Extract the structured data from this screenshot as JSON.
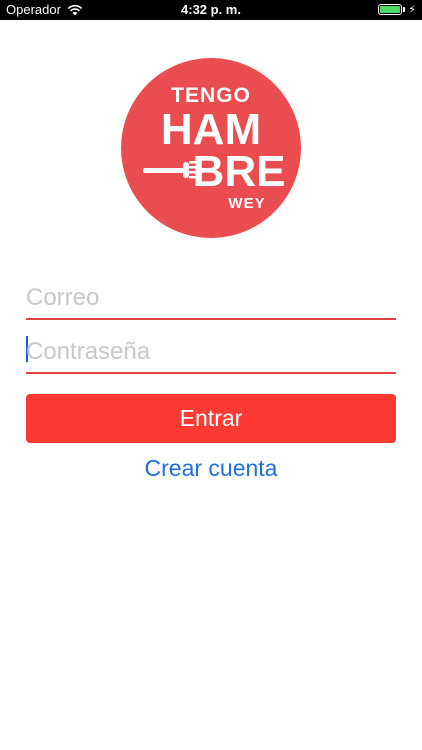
{
  "status_bar": {
    "carrier": "Operador",
    "time": "4:32 p. m.",
    "battery_level": 1.0,
    "battery_color": "#4cd964"
  },
  "logo": {
    "line1": "TENGO",
    "line2a": "HAM",
    "line2b": "BRE",
    "line3": "WEY",
    "color": "#ea4d50"
  },
  "form": {
    "email_placeholder": "Correo",
    "email_value": "",
    "password_placeholder": "Contraseña",
    "password_value": "",
    "login_label": "Entrar",
    "register_label": "Crear cuenta"
  },
  "colors": {
    "accent": "#fc3a31",
    "underline": "#e24246",
    "link": "#1e6fd9"
  }
}
